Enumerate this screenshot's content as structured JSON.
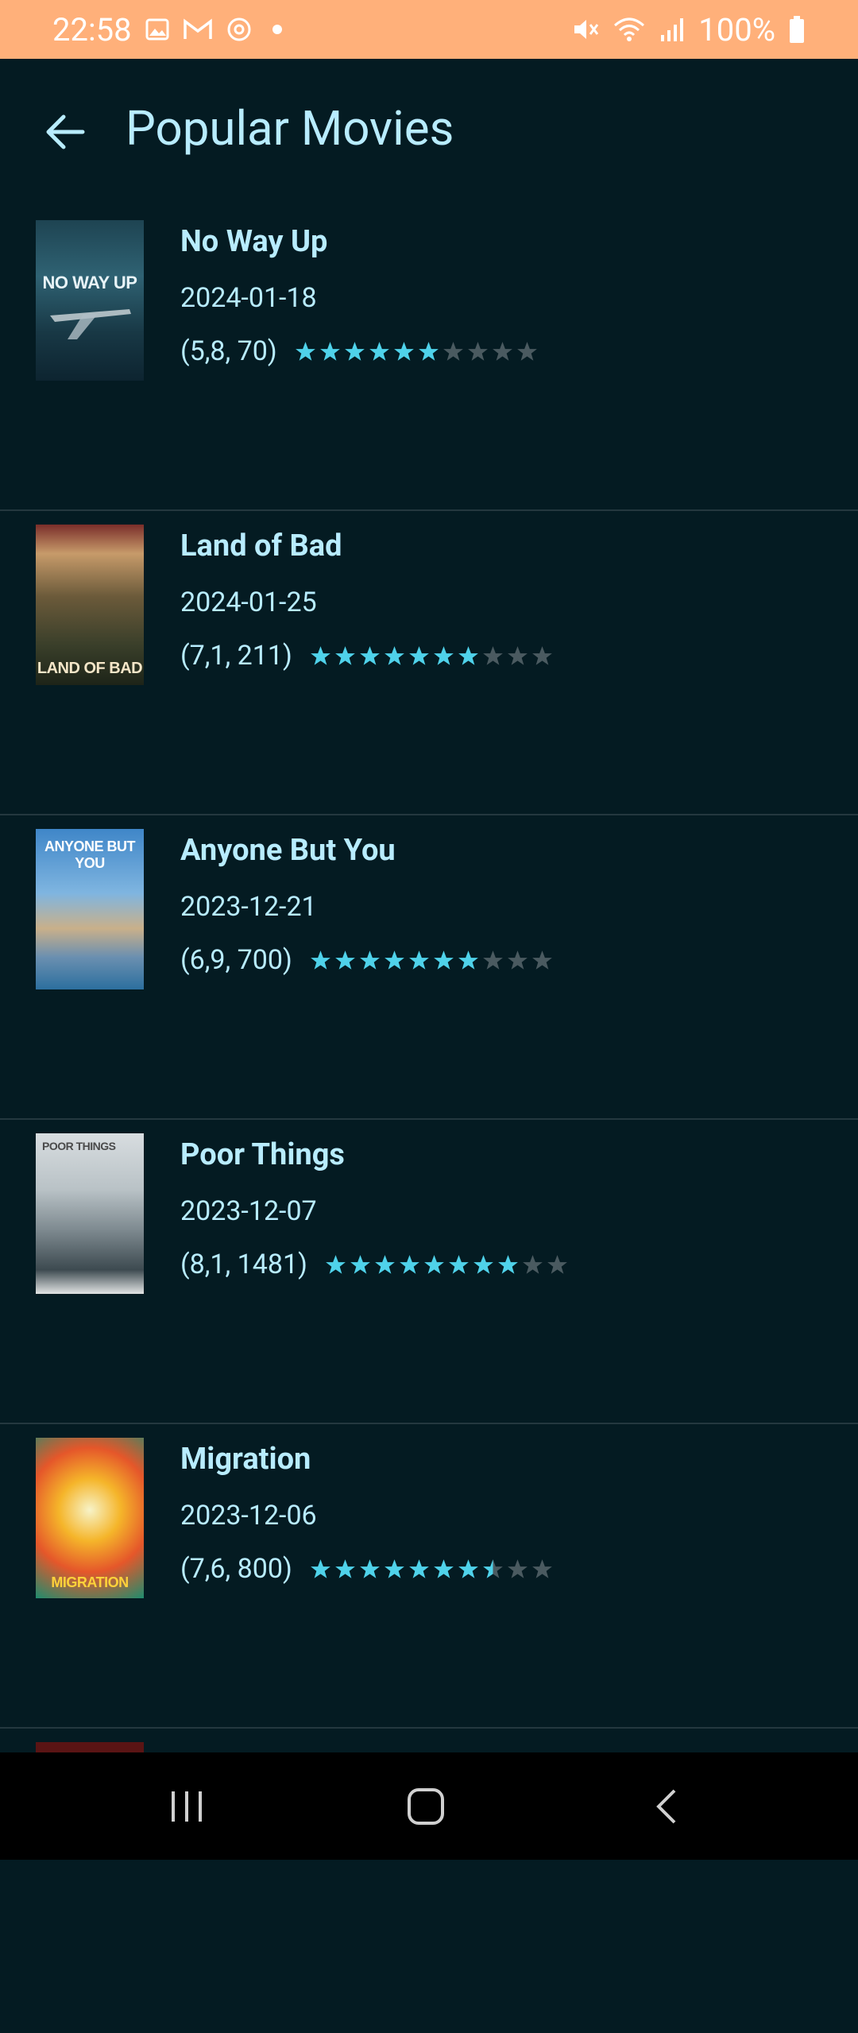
{
  "status_bar": {
    "time": "22:58",
    "battery": "100%",
    "left_icons": [
      "gallery-icon",
      "gmail-icon",
      "sync-icon",
      "dot-icon"
    ],
    "right_icons": [
      "mute-icon",
      "wifi-icon",
      "signal-icon",
      "battery-icon"
    ]
  },
  "app_bar": {
    "title": "Popular Movies"
  },
  "colors": {
    "status_bar": "#ffb07a",
    "background": "#041b22",
    "text": "#b8ecff",
    "star_filled": "#4fd2ea",
    "star_empty": "#4a5a60",
    "divider": "#24383f"
  },
  "movies": [
    {
      "title": "No Way Up",
      "date": "2024-01-18",
      "rating_label": "(5,8, 70)",
      "rating": 5.8,
      "poster_text": "NO WAY UP"
    },
    {
      "title": "Land of Bad",
      "date": "2024-01-25",
      "rating_label": "(7,1, 211)",
      "rating": 7.1,
      "poster_text": "LAND OF BAD"
    },
    {
      "title": "Anyone But You",
      "date": "2023-12-21",
      "rating_label": "(6,9, 700)",
      "rating": 6.9,
      "poster_text": "ANYONE BUT YOU"
    },
    {
      "title": "Poor Things",
      "date": "2023-12-07",
      "rating_label": "(8,1, 1481)",
      "rating": 8.1,
      "poster_text": "POOR THINGS"
    },
    {
      "title": "Migration",
      "date": "2023-12-06",
      "rating_label": "(7,6, 800)",
      "rating": 7.6,
      "poster_text": "MIGRATION"
    }
  ],
  "nav_bar": {
    "items": [
      "recent-apps-icon",
      "home-icon",
      "back-icon"
    ]
  }
}
